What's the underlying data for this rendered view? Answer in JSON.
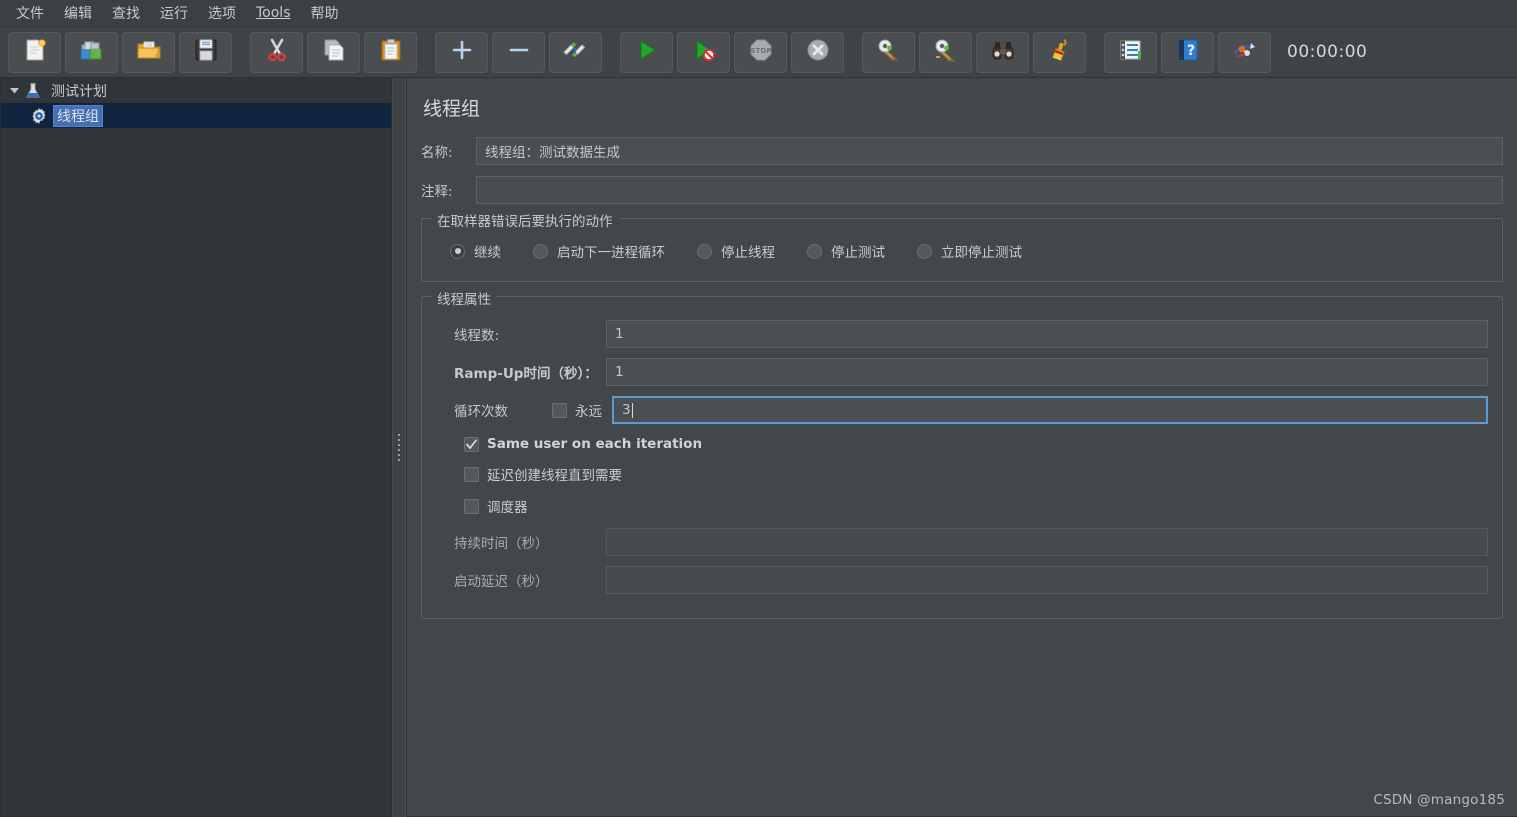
{
  "window": {
    "timer": "00:00:00",
    "watermark": "CSDN @mango185"
  },
  "menubar": {
    "items": [
      {
        "label": "文件",
        "mnemonic": ""
      },
      {
        "label": "编辑",
        "mnemonic": ""
      },
      {
        "label": "查找",
        "mnemonic": ""
      },
      {
        "label": "运行",
        "mnemonic": ""
      },
      {
        "label": "选项",
        "mnemonic": ""
      },
      {
        "label": "Tools",
        "mnemonic": "T"
      },
      {
        "label": "帮助",
        "mnemonic": ""
      }
    ]
  },
  "toolbar": {
    "buttons": [
      {
        "name": "new-icon",
        "tooltip": "新建"
      },
      {
        "name": "templates-icon",
        "tooltip": "模板"
      },
      {
        "name": "open-icon",
        "tooltip": "打开"
      },
      {
        "name": "save-icon",
        "tooltip": "保存"
      },
      {
        "name": "cut-icon",
        "tooltip": "剪切"
      },
      {
        "name": "copy-icon",
        "tooltip": "复制"
      },
      {
        "name": "paste-icon",
        "tooltip": "粘贴"
      },
      {
        "name": "expand-icon",
        "tooltip": "展开"
      },
      {
        "name": "collapse-icon",
        "tooltip": "收起"
      },
      {
        "name": "toggle-icon",
        "tooltip": "切换"
      },
      {
        "name": "start-icon",
        "tooltip": "启动"
      },
      {
        "name": "start-no-pauses-icon",
        "tooltip": "无间隔启动"
      },
      {
        "name": "stop-icon",
        "tooltip": "停止"
      },
      {
        "name": "shutdown-icon",
        "tooltip": "关闭"
      },
      {
        "name": "clear-icon",
        "tooltip": "清除"
      },
      {
        "name": "clear-all-icon",
        "tooltip": "清除全部"
      },
      {
        "name": "search-icon",
        "tooltip": "搜索"
      },
      {
        "name": "clear-search-icon",
        "tooltip": "重置搜索"
      },
      {
        "name": "function-helper-icon",
        "tooltip": "函数助手"
      },
      {
        "name": "help-icon",
        "tooltip": "帮助"
      },
      {
        "name": "undo-redo-icon",
        "tooltip": "撤销/重做"
      }
    ]
  },
  "tree": {
    "nodes": [
      {
        "label": "测试计划",
        "icon": "flask-icon",
        "expanded": true,
        "selected": false
      },
      {
        "label": "线程组",
        "icon": "gear-icon",
        "expanded": false,
        "selected": true
      }
    ]
  },
  "panel": {
    "title": "线程组",
    "name_label": "名称:",
    "name_value": "线程组：测试数据生成",
    "comment_label": "注释:",
    "comment_value": "",
    "error_action": {
      "group_title": "在取样器错误后要执行的动作",
      "options": [
        {
          "label": "继续",
          "selected": true
        },
        {
          "label": "启动下一进程循环",
          "selected": false
        },
        {
          "label": "停止线程",
          "selected": false
        },
        {
          "label": "停止测试",
          "selected": false
        },
        {
          "label": "立即停止测试",
          "selected": false
        }
      ]
    },
    "thread_properties": {
      "group_title": "线程属性",
      "num_threads_label": "线程数:",
      "num_threads_value": "1",
      "ramp_up_label": "Ramp-Up时间（秒）：",
      "ramp_up_value": "1",
      "loop_count_label": "循环次数",
      "forever_label": "永远",
      "forever_checked": false,
      "loop_count_value": "3",
      "same_user_label": "Same user on each iteration",
      "same_user_checked": true,
      "delayed_start_label": "延迟创建线程直到需要",
      "delayed_start_checked": false,
      "scheduler_label": "调度器",
      "scheduler_checked": false,
      "duration_label": "持续时间（秒）",
      "duration_value": "",
      "startup_delay_label": "启动延迟（秒）",
      "startup_delay_value": ""
    }
  },
  "colors": {
    "panel_bg": "#434749",
    "tree_bg": "#30353a",
    "selection_blue": "#436fb5",
    "selected_row_bg": "#10243f",
    "focus_border": "#5b9bd5",
    "text": "#c8c9ca"
  }
}
